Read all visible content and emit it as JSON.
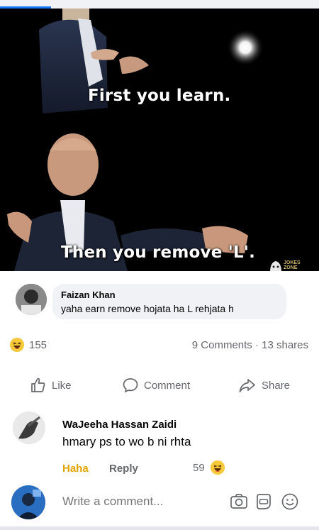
{
  "post": {
    "caption_top": "First you learn.",
    "caption_bottom": "Then you remove 'L'.",
    "watermark": "JOKES ZONE"
  },
  "first_comment": {
    "author": "Faizan Khan",
    "text": "yaha earn remove hojata ha L rehjata h"
  },
  "stats": {
    "reaction_icon": "haha-emoji",
    "reaction_count": "155",
    "comments_shares": "9 Comments · 13 shares"
  },
  "actions": {
    "like": "Like",
    "comment": "Comment",
    "share": "Share"
  },
  "second_comment": {
    "author": "WaJeeha Hassan Zaidi",
    "text": "hmary ps to wo b ni rhta",
    "haha_label": "Haha",
    "reply_label": "Reply",
    "reaction_count": "59"
  },
  "composer": {
    "placeholder": "Write a comment..."
  },
  "colors": {
    "accent": "#1877f2",
    "haha": "#e2a400",
    "muted": "#65676b"
  }
}
